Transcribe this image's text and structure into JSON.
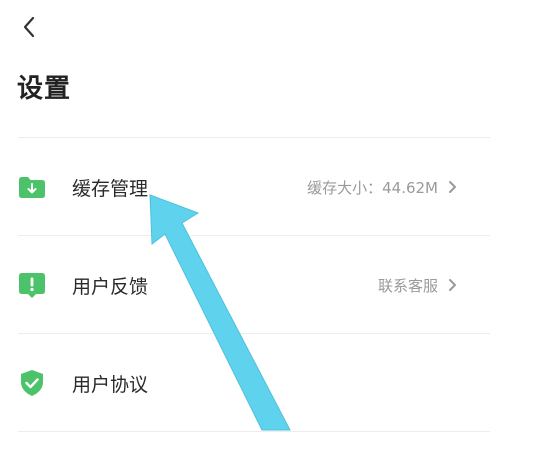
{
  "header": {
    "back_icon": "chevron-left-icon",
    "title": "设置"
  },
  "settings": {
    "items": [
      {
        "label": "缓存管理",
        "value": "缓存大小：44.62M",
        "icon": "folder-download-icon",
        "color": "#4cc36b"
      },
      {
        "label": "用户反馈",
        "value": "联系客服",
        "icon": "feedback-exclamation-icon",
        "color": "#4cc36b"
      },
      {
        "label": "用户协议",
        "value": "",
        "icon": "shield-check-icon",
        "color": "#4cc36b"
      }
    ]
  },
  "annotation": {
    "arrow_color": "#5fd3ee"
  }
}
